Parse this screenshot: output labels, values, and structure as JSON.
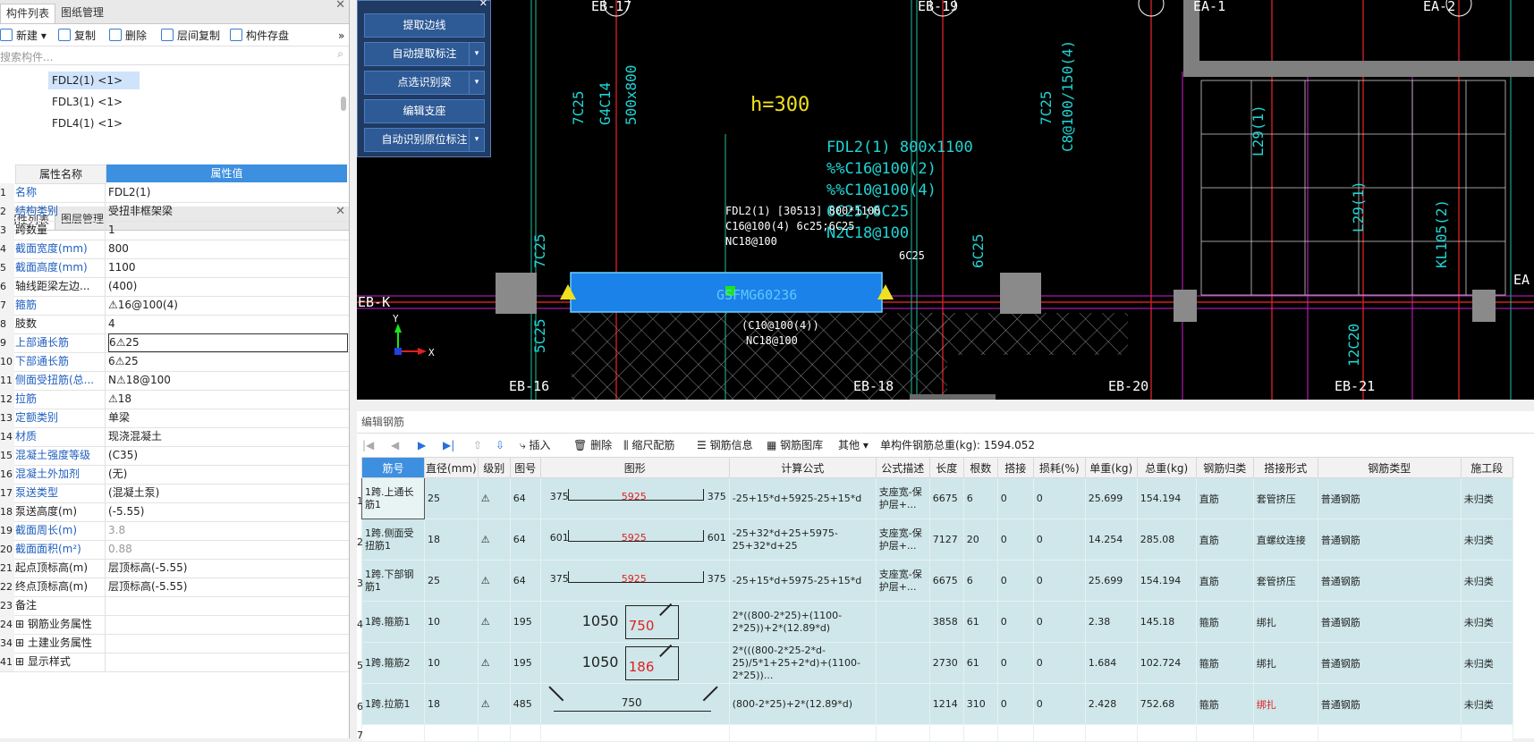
{
  "components_panel": {
    "tabs": [
      "构件列表",
      "图纸管理"
    ],
    "toolbar": [
      "新建",
      "复制",
      "删除",
      "层间复制",
      "构件存盘"
    ],
    "search_placeholder": "搜索构件...",
    "items": [
      "FDL2(1) <1>",
      "FDL3(1) <1>",
      "FDL4(1) <1>"
    ],
    "selected_item": "FDL2(1) <1>"
  },
  "properties_panel": {
    "tabs": [
      "属性列表",
      "图层管理"
    ],
    "headers": [
      "属性名称",
      "属性值"
    ],
    "rows": [
      {
        "num": "1",
        "name": "名称",
        "value": "FDL2(1)",
        "blue": true
      },
      {
        "num": "2",
        "name": "结构类别",
        "value": "受扭非框架梁",
        "blue": true
      },
      {
        "num": "3",
        "name": "跨数量",
        "value": "1",
        "blue": false
      },
      {
        "num": "4",
        "name": "截面宽度(mm)",
        "value": "800",
        "blue": true
      },
      {
        "num": "5",
        "name": "截面高度(mm)",
        "value": "1100",
        "blue": true
      },
      {
        "num": "6",
        "name": "轴线距梁左边...",
        "value": "(400)",
        "blue": false
      },
      {
        "num": "7",
        "name": "箍筋",
        "value": "⚠16@100(4)",
        "blue": true
      },
      {
        "num": "8",
        "name": "肢数",
        "value": "4",
        "blue": false
      },
      {
        "num": "9",
        "name": "上部通长筋",
        "value": "6⚠25",
        "blue": true
      },
      {
        "num": "10",
        "name": "下部通长筋",
        "value": "6⚠25",
        "blue": true
      },
      {
        "num": "11",
        "name": "侧面受扭筋(总...",
        "value": "N⚠18@100",
        "blue": true
      },
      {
        "num": "12",
        "name": "拉筋",
        "value": "⚠18",
        "blue": true
      },
      {
        "num": "13",
        "name": "定额类别",
        "value": "单梁",
        "blue": true
      },
      {
        "num": "14",
        "name": "材质",
        "value": "现浇混凝土",
        "blue": true
      },
      {
        "num": "15",
        "name": "混凝土强度等级",
        "value": "(C35)",
        "blue": true
      },
      {
        "num": "16",
        "name": "混凝土外加剂",
        "value": "(无)",
        "blue": true
      },
      {
        "num": "17",
        "name": "泵送类型",
        "value": "(混凝土泵)",
        "blue": true
      },
      {
        "num": "18",
        "name": "泵送高度(m)",
        "value": "(-5.55)",
        "blue": false
      },
      {
        "num": "19",
        "name": "截面周长(m)",
        "value": "3.8",
        "blue": true,
        "gray": true
      },
      {
        "num": "20",
        "name": "截面面积(m²)",
        "value": "0.88",
        "blue": true,
        "gray": true
      },
      {
        "num": "21",
        "name": "起点顶标高(m)",
        "value": "层顶标高(-5.55)",
        "blue": false
      },
      {
        "num": "22",
        "name": "终点顶标高(m)",
        "value": "层顶标高(-5.55)",
        "blue": false
      },
      {
        "num": "23",
        "name": "备注",
        "value": "",
        "blue": false
      },
      {
        "num": "24",
        "name": "⊞ 钢筋业务属性",
        "value": "",
        "blue": false
      },
      {
        "num": "34",
        "name": "⊞ 土建业务属性",
        "value": "",
        "blue": false
      },
      {
        "num": "41",
        "name": "⊞ 显示样式",
        "value": "",
        "blue": false
      }
    ]
  },
  "cad_panel": {
    "buttons": [
      "提取边线",
      "自动提取标注",
      "点选识别梁",
      "编辑支座",
      "自动识别原位标注"
    ]
  },
  "cad": {
    "axis_labels": [
      "EB-17",
      "EB-19",
      "EA-1",
      "EA-2",
      "EB-K",
      "EB-16",
      "EB-18",
      "EB-20",
      "EB-21",
      "EA"
    ],
    "h_label": "h=300",
    "beam_annotation": [
      "FDL2(1) [30513] 800*1100",
      "C16@100(4) 6c25;6C25",
      "NC18@100"
    ],
    "beam_label_6c25": "6C25",
    "beam_below": [
      "(C10@100(4))",
      "NC18@100"
    ],
    "cyan_texts": [
      "FDL2(1) 800x1100",
      "%%C16@100(2)",
      "%%C10@100(4)",
      "6C25;6C25",
      "N2C18@100"
    ],
    "vertical_texts": [
      "7C25",
      "G4C14",
      "500x800",
      "7C25",
      "C8@100/150(4)",
      "7C25",
      "6C25",
      "5C25",
      "12C20",
      "L29(1)",
      "L29(1)",
      "KL105(2)"
    ],
    "beam_id": "GSFMG60236"
  },
  "rebar_panel": {
    "title": "编辑钢筋",
    "toolbar": [
      "插入",
      "删除",
      "缩尺配筋",
      "钢筋信息",
      "钢筋图库",
      "其他"
    ],
    "total_label": "单构件钢筋总重(kg):",
    "total_value": "1594.052",
    "columns": [
      "筋号",
      "直径(mm)",
      "级别",
      "图号",
      "图形",
      "计算公式",
      "公式描述",
      "长度",
      "根数",
      "搭接",
      "损耗(%)",
      "单重(kg)",
      "总重(kg)",
      "钢筋归类",
      "搭接形式",
      "钢筋类型",
      "施工段"
    ],
    "rows": [
      {
        "idx": "1",
        "name": "1跨.上通长筋1",
        "dia": "25",
        "grade": "⚠",
        "fig": "64",
        "shape": {
          "left": "375",
          "mid": "5925",
          "right": "375"
        },
        "formula": "-25+15*d+5925-25+15*d",
        "desc": "支座宽-保护层+...",
        "len": "6675",
        "count": "6",
        "lap": "0",
        "loss": "0",
        "unit": "25.699",
        "total": "154.194",
        "cls": "直筋",
        "lapform": "套管挤压",
        "type": "普通钢筋",
        "stage": "未归类"
      },
      {
        "idx": "2",
        "name": "1跨.侧面受扭筋1",
        "dia": "18",
        "grade": "⚠",
        "fig": "64",
        "shape": {
          "left": "601",
          "mid": "5925",
          "right": "601"
        },
        "formula": "-25+32*d+25+5975-25+32*d+25",
        "desc": "支座宽-保护层+...",
        "len": "7127",
        "count": "20",
        "lap": "0",
        "loss": "0",
        "unit": "14.254",
        "total": "285.08",
        "cls": "直筋",
        "lapform": "直螺纹连接",
        "type": "普通钢筋",
        "stage": "未归类"
      },
      {
        "idx": "3",
        "name": "1跨.下部钢筋1",
        "dia": "25",
        "grade": "⚠",
        "fig": "64",
        "shape": {
          "left": "375",
          "mid": "5925",
          "right": "375"
        },
        "formula": "-25+15*d+5975-25+15*d",
        "desc": "支座宽-保护层+...",
        "len": "6675",
        "count": "6",
        "lap": "0",
        "loss": "0",
        "unit": "25.699",
        "total": "154.194",
        "cls": "直筋",
        "lapform": "套管挤压",
        "type": "普通钢筋",
        "stage": "未归类"
      },
      {
        "idx": "4",
        "name": "1跨.箍筋1",
        "dia": "10",
        "grade": "⚠",
        "fig": "195",
        "shape": {
          "left": "1050",
          "mid": "750",
          "right": ""
        },
        "formula": "2*((800-2*25)+(1100-2*25))+2*(12.89*d)",
        "desc": "",
        "len": "3858",
        "count": "61",
        "lap": "0",
        "loss": "0",
        "unit": "2.38",
        "total": "145.18",
        "cls": "箍筋",
        "lapform": "绑扎",
        "type": "普通钢筋",
        "stage": "未归类"
      },
      {
        "idx": "5",
        "name": "1跨.箍筋2",
        "dia": "10",
        "grade": "⚠",
        "fig": "195",
        "shape": {
          "left": "1050",
          "mid": "186",
          "right": ""
        },
        "formula": "2*(((800-2*25-2*d-25)/5*1+25+2*d)+(1100-2*25))...",
        "desc": "",
        "len": "2730",
        "count": "61",
        "lap": "0",
        "loss": "0",
        "unit": "1.684",
        "total": "102.724",
        "cls": "箍筋",
        "lapform": "绑扎",
        "type": "普通钢筋",
        "stage": "未归类"
      },
      {
        "idx": "6",
        "name": "1跨.拉筋1",
        "dia": "18",
        "grade": "⚠",
        "fig": "485",
        "shape": {
          "left": "",
          "mid": "750",
          "right": ""
        },
        "formula": "(800-2*25)+2*(12.89*d)",
        "desc": "",
        "len": "1214",
        "count": "310",
        "lap": "0",
        "loss": "0",
        "unit": "2.428",
        "total": "752.68",
        "cls": "箍筋",
        "lapform": "绑扎",
        "type": "普通钢筋",
        "stage": "未归类",
        "lapform_red": true
      }
    ],
    "empty_row_idx": "7"
  }
}
